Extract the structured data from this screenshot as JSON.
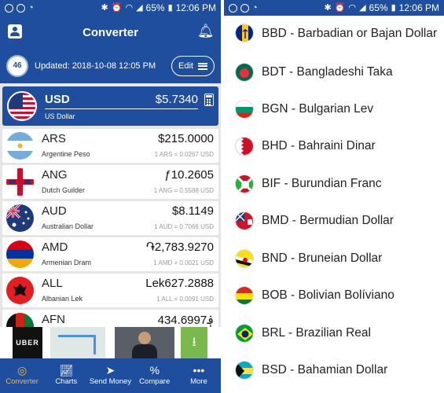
{
  "left": {
    "status": {
      "battery": "65%",
      "time": "12:06 PM"
    },
    "header": {
      "title": "Converter"
    },
    "update": {
      "badge": "46",
      "text": "Updated: 2018-10-08 12:05 PM",
      "edit_label": "Edit"
    },
    "base": {
      "code": "USD",
      "name": "US Dollar",
      "value": "$5.7340"
    },
    "rows": [
      {
        "code": "ARS",
        "name": "Argentine Peso",
        "value": "$215.0000",
        "rate": "1 ARS = 0.0267 USD"
      },
      {
        "code": "ANG",
        "name": "Dutch Guilder",
        "value": "ƒ10.2605",
        "rate": "1 ANG = 0.5588 USD"
      },
      {
        "code": "AUD",
        "name": "Australian Dollar",
        "value": "$8.1149",
        "rate": "1 AUD = 0.7066 USD"
      },
      {
        "code": "AMD",
        "name": "Armenian Dram",
        "value": "֏2,783.9270",
        "rate": "1 AMD = 0.0021 USD"
      },
      {
        "code": "ALL",
        "name": "Albanian Lek",
        "value": "Lek627.2888",
        "rate": "1 ALL = 0.0091 USD"
      },
      {
        "code": "AFN",
        "name": "",
        "value": "434.6997؋",
        "rate": ""
      }
    ],
    "ad": {
      "brand": "UBER"
    },
    "nav": [
      {
        "label": "Converter",
        "icon": "coins-icon",
        "active": true
      },
      {
        "label": "Charts",
        "icon": "chart-icon",
        "active": false
      },
      {
        "label": "Send Money",
        "icon": "send-icon",
        "active": false
      },
      {
        "label": "Compare",
        "icon": "percent-icon",
        "active": false
      },
      {
        "label": "More",
        "icon": "more-icon",
        "active": false
      }
    ]
  },
  "right": {
    "status": {
      "battery": "65%",
      "time": "12:06 PM"
    },
    "currencies": [
      {
        "label": "BBD - Barbadian or Bajan Dollar",
        "flag": "barbados-flag"
      },
      {
        "label": "BDT - Bangladeshi Taka",
        "flag": "bangladesh-flag"
      },
      {
        "label": "BGN - Bulgarian Lev",
        "flag": "bulgaria-flag"
      },
      {
        "label": "BHD - Bahraini Dinar",
        "flag": "bahrain-flag"
      },
      {
        "label": "BIF - Burundian Franc",
        "flag": "burundi-flag"
      },
      {
        "label": "BMD - Bermudian Dollar",
        "flag": "bermuda-flag"
      },
      {
        "label": "BND - Bruneian Dollar",
        "flag": "brunei-flag"
      },
      {
        "label": "BOB - Bolivian Bolíviano",
        "flag": "bolivia-flag"
      },
      {
        "label": "BRL - Brazilian Real",
        "flag": "brazil-flag"
      },
      {
        "label": "BSD - Bahamian Dollar",
        "flag": "bahamas-flag"
      }
    ]
  },
  "colors": {
    "primary": "#1f4e9e",
    "active_nav": "#f2b53a",
    "background": "#e6e6e6"
  }
}
